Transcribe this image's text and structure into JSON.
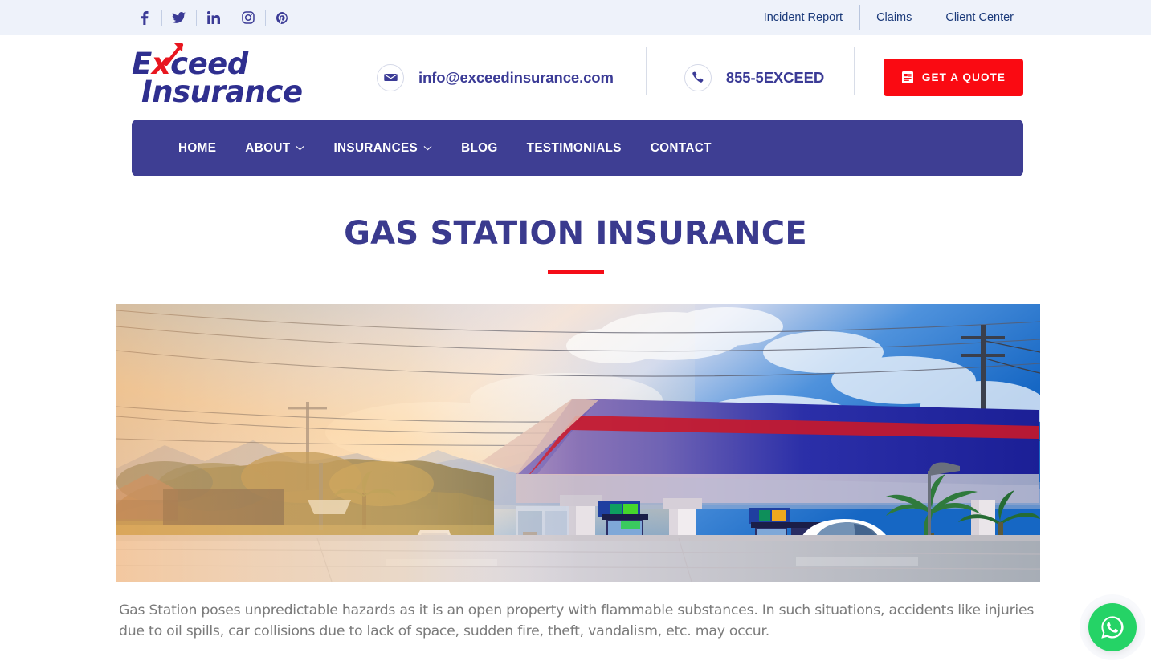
{
  "topbar": {
    "social": [
      {
        "name": "facebook-icon",
        "label": "Facebook"
      },
      {
        "name": "twitter-icon",
        "label": "Twitter"
      },
      {
        "name": "linkedin-icon",
        "label": "LinkedIn"
      },
      {
        "name": "instagram-icon",
        "label": "Instagram"
      },
      {
        "name": "pinterest-icon",
        "label": "Pinterest"
      }
    ],
    "links": [
      {
        "label": "Incident Report"
      },
      {
        "label": "Claims"
      },
      {
        "label": "Client Center"
      }
    ]
  },
  "header": {
    "logo": {
      "line1_prefix": "E",
      "line1_x": "x",
      "line1_suffix": "ceed",
      "line2": "Insurance"
    },
    "email": "info@exceedinsurance.com",
    "phone": "855-5EXCEED",
    "quote_label": "GET A QUOTE"
  },
  "nav": {
    "items": [
      {
        "label": "HOME",
        "has_dropdown": false
      },
      {
        "label": "ABOUT",
        "has_dropdown": true
      },
      {
        "label": "INSURANCES",
        "has_dropdown": true
      },
      {
        "label": "BLOG",
        "has_dropdown": false
      },
      {
        "label": "TESTIMONIALS",
        "has_dropdown": false
      },
      {
        "label": "CONTACT",
        "has_dropdown": false
      }
    ]
  },
  "main": {
    "title": "GAS STATION INSURANCE",
    "hero_alt": "Gas station with blue canopy, fuel pumps, white car and pickup truck at sunset",
    "paragraph": "Gas Station poses unpredictable hazards as it is an open property with flammable substances. In such situations, accidents like injuries due to oil spills, car collisions due to lack of space, sudden fire, theft, vandalism, etc. may occur."
  },
  "floating": {
    "whatsapp_label": "WhatsApp"
  },
  "colors": {
    "topbar_bg": "#eef2fa",
    "toplink": "#1b3a7a",
    "brand_indigo": "#3b3b96",
    "nav_bg": "#3e3e93",
    "accent_red": "#fa0a12",
    "title": "#3a3a8e",
    "body_text": "#7b7b7b",
    "whatsapp_green": "#25d366"
  }
}
